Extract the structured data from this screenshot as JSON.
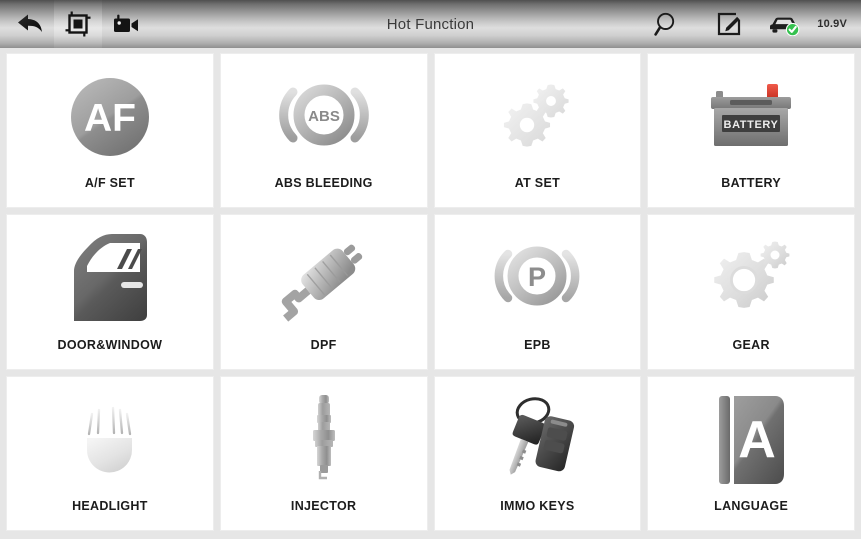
{
  "toolbar": {
    "title": "Hot Function",
    "left_buttons": [
      {
        "name": "back-icon",
        "label": "Back"
      },
      {
        "name": "screenshot-icon",
        "label": "Screenshot",
        "active": true
      },
      {
        "name": "record-video-icon",
        "label": "Record Video"
      }
    ],
    "right_buttons": [
      {
        "name": "search-icon",
        "label": "Search"
      },
      {
        "name": "edit-icon",
        "label": "Edit"
      },
      {
        "name": "vehicle-connection-icon",
        "label": "Vehicle Connected"
      }
    ],
    "voltage": "10.9V",
    "status_ok_color": "#35c14f"
  },
  "grid": {
    "items": [
      {
        "id": "af-set",
        "label": "A/F SET",
        "icon": "af-set-icon"
      },
      {
        "id": "abs-bleeding",
        "label": "ABS BLEEDING",
        "icon": "abs-bleeding-icon"
      },
      {
        "id": "at-set",
        "label": "AT SET",
        "icon": "at-set-icon"
      },
      {
        "id": "battery",
        "label": "BATTERY",
        "icon": "battery-icon"
      },
      {
        "id": "door-window",
        "label": "DOOR&WINDOW",
        "icon": "car-door-icon"
      },
      {
        "id": "dpf",
        "label": "DPF",
        "icon": "exhaust-muffler-icon"
      },
      {
        "id": "epb",
        "label": "EPB",
        "icon": "parking-brake-icon"
      },
      {
        "id": "gear",
        "label": "GEAR",
        "icon": "gear-icon"
      },
      {
        "id": "headlight",
        "label": "HEADLIGHT",
        "icon": "headlight-icon"
      },
      {
        "id": "injector",
        "label": "INJECTOR",
        "icon": "spark-plug-icon"
      },
      {
        "id": "immo-keys",
        "label": "IMMO KEYS",
        "icon": "car-keys-icon"
      },
      {
        "id": "language",
        "label": "LANGUAGE",
        "icon": "book-letter-a-icon"
      }
    ],
    "icon_texts": {
      "af": "AF",
      "abs": "ABS",
      "epb": "P",
      "battery": "BATTERY",
      "language": "A"
    }
  }
}
